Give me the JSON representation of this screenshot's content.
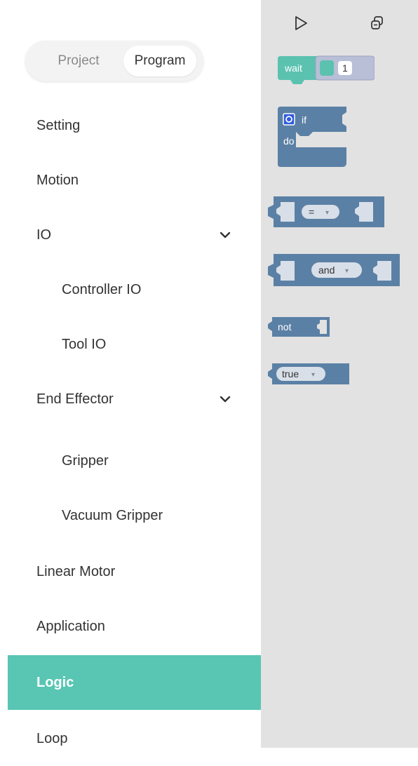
{
  "toggle": {
    "project": "Project",
    "program": "Program"
  },
  "nav": {
    "setting": "Setting",
    "motion": "Motion",
    "io": "IO",
    "controller_io": "Controller IO",
    "tool_io": "Tool IO",
    "end_effector": "End Effector",
    "gripper": "Gripper",
    "vacuum_gripper": "Vacuum Gripper",
    "linear_motor": "Linear Motor",
    "application": "Application",
    "logic": "Logic",
    "loop": "Loop"
  },
  "toolbar": {
    "run_icon": "play-icon",
    "copy_icon": "copy-icon"
  },
  "blocks": {
    "wait_label": "wait",
    "wait_value": "1",
    "if_label": "if",
    "do_label": "do",
    "compare_op": "=",
    "logic_op": "and",
    "not_label": "not",
    "bool_value": "true"
  },
  "colors": {
    "accent": "#58c6b3",
    "block_logic": "#5b80a5",
    "block_wait": "#5bc2b0",
    "workspace": "#e2e2e2",
    "gear": "#2f5cdc"
  }
}
